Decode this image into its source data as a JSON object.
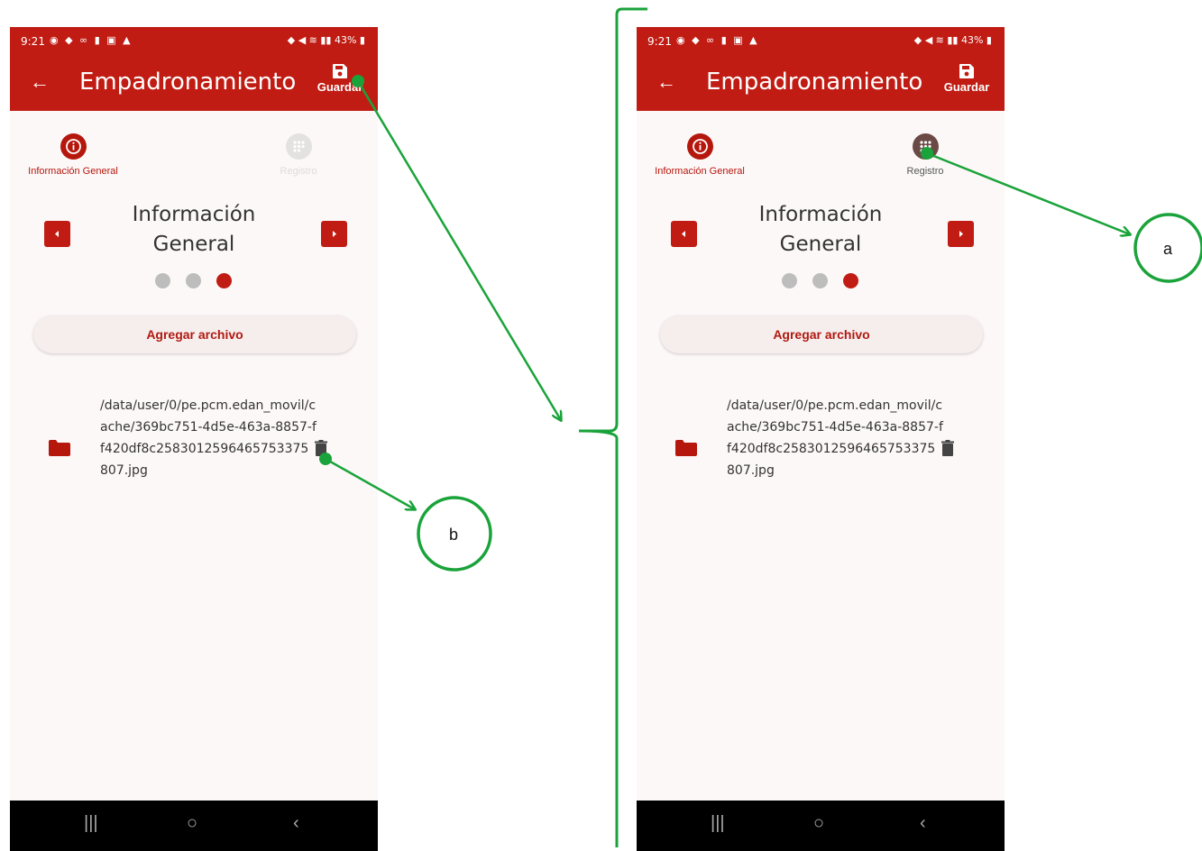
{
  "status_bar": {
    "time": "9:21",
    "battery": "43%"
  },
  "app_bar": {
    "title": "Empadronamiento",
    "save_label": "Guardar"
  },
  "steps": [
    {
      "label": "Información General"
    },
    {
      "label": "Registro"
    }
  ],
  "section": {
    "title_line1": "Información",
    "title_line2": "General"
  },
  "add_button": {
    "label": "Agregar archivo"
  },
  "file": {
    "path": "/data/user/0/pe.pcm.edan_movil/cache/369bc751-4d5e-463a-8857-ff420df8c2583012596465753375807.jpg"
  },
  "annotations": {
    "a": "a",
    "b": "b"
  },
  "colors": {
    "primary": "#c01c13",
    "annotation": "#1aa33a",
    "disabled": "#e4e1e1",
    "step_registro_active": "#6b4a45"
  }
}
